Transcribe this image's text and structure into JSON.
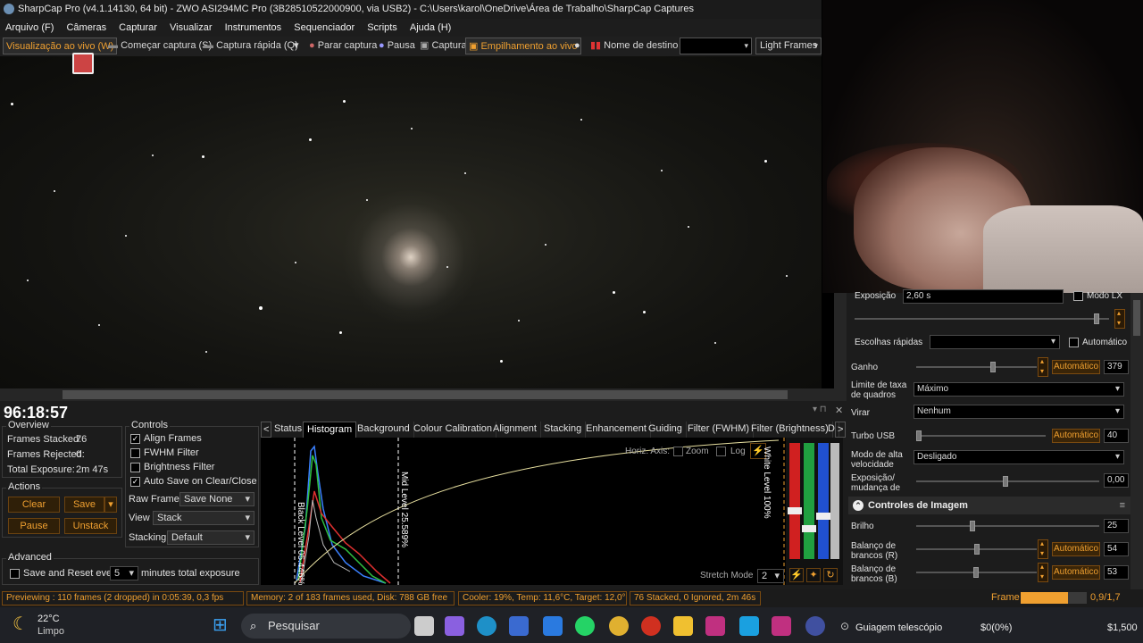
{
  "window": {
    "title": "SharpCap Pro (v4.1.14130, 64 bit) - ZWO ASI294MC Pro (3B28510522000900, via USB2) - C:\\Users\\karol\\OneDrive\\Área de Trabalho\\SharpCap Captures"
  },
  "menu": [
    "Arquivo (F)",
    "Câmeras",
    "Capturar",
    "Visualizar",
    "Instrumentos",
    "Sequenciador",
    "Scripts",
    "Ajuda (H)"
  ],
  "toolbar": {
    "live_view": "Visualização ao vivo (W)",
    "start_capture": "Começar captura (S)",
    "quick_capture": "Captura rápida (Q)",
    "stop_capture": "Parar captura",
    "pause": "Pausa",
    "capture": "Captura",
    "live_stack": "Empilhamento ao vivo",
    "target_name": "Nome de destino",
    "target_value": "",
    "frame_type": "Light Frames"
  },
  "clock": "96:18:57",
  "overview": {
    "title": "Overview",
    "frames_stacked_label": "Frames Stacked:",
    "frames_stacked": "76",
    "frames_rejected_label": "Frames Rejected:",
    "frames_rejected": "0",
    "total_exposure_label": "Total Exposure:",
    "total_exposure": "2m 47s"
  },
  "actions": {
    "title": "Actions",
    "clear": "Clear",
    "save": "Save",
    "pause": "Pause",
    "unstack": "Unstack"
  },
  "advanced": {
    "title": "Advanced",
    "save_reset": "Save and Reset every",
    "minutes": "5",
    "suffix": "minutes total exposure"
  },
  "controls": {
    "title": "Controls",
    "align": "Align Frames",
    "fwhm": "FWHM Filter",
    "brightness": "Brightness Filter",
    "autosave": "Auto Save on Clear/Close",
    "raw_frames_label": "Raw Frames",
    "raw_frames": "Save None",
    "view_label": "View",
    "view": "Stack",
    "stacking_label": "Stacking",
    "stacking": "Default"
  },
  "tabs": [
    "Status",
    "Histogram",
    "Background",
    "Colour Calibration",
    "Alignment",
    "Stacking",
    "Enhancement",
    "Guiding",
    "Filter (FWHM)",
    "Filter (Brightness)",
    "D"
  ],
  "histogram": {
    "horiz_axis": "Horiz. Axis:",
    "zoom": "Zoom",
    "log": "Log",
    "black_level": "Black Level 05.446%",
    "mid_level": "Mid Level 25.589%",
    "white_level": "White Level 100%",
    "stretch_mode": "Stretch Mode",
    "stretch_value": "2"
  },
  "camera": {
    "exposure_label": "Exposição",
    "exposure": "2,60 s",
    "lx_mode": "Modo LX",
    "quick_picks": "Escolhas rápidas",
    "automatic": "Automático",
    "gain_label": "Ganho",
    "gain_auto": "Automático",
    "gain": "379",
    "frame_limit_label": "Limite de taxa de quadros",
    "frame_limit": "Máximo",
    "flip_label": "Virar",
    "flip": "Nenhum",
    "turbo_label": "Turbo USB",
    "turbo_auto": "Automático",
    "turbo": "40",
    "hs_label": "Modo de alta velocidade",
    "hs": "Desligado",
    "exp_gain_label": "Exposição/ mudança de ganho",
    "exp_gain": "0,00"
  },
  "image_controls": {
    "title": "Controles de Imagem",
    "brightness_label": "Brilho",
    "brightness": "25",
    "wb_r_label": "Balanço de brancos (R)",
    "wb_r_auto": "Automático",
    "wb_r": "54",
    "wb_b_label": "Balanço de brancos (B)",
    "wb_b_auto": "Automático",
    "wb_b": "53"
  },
  "status": {
    "previewing": "Previewing : 110 frames (2 dropped) in 0:05:39, 0,3 fps",
    "memory": "Memory: 2 of 183 frames used, Disk: 788 GB free",
    "cooler": "Cooler: 19%, Temp: 11,6°C, Target: 12,0°C",
    "stacked": "76 Stacked, 0 Ignored, 2m 46s",
    "frame_label": "Frame :",
    "frame_progress": 0.72,
    "frame_value": "0,9/1,7"
  },
  "taskbar": {
    "temp": "22°C",
    "weather": "Limpo",
    "search": "Pesquisar",
    "guide": "Guiagem telescópio",
    "money1": "$0(0%)",
    "money2": "$1,500"
  },
  "colors": {
    "accent": "#f0a030",
    "panel": "#1c1c1c"
  }
}
